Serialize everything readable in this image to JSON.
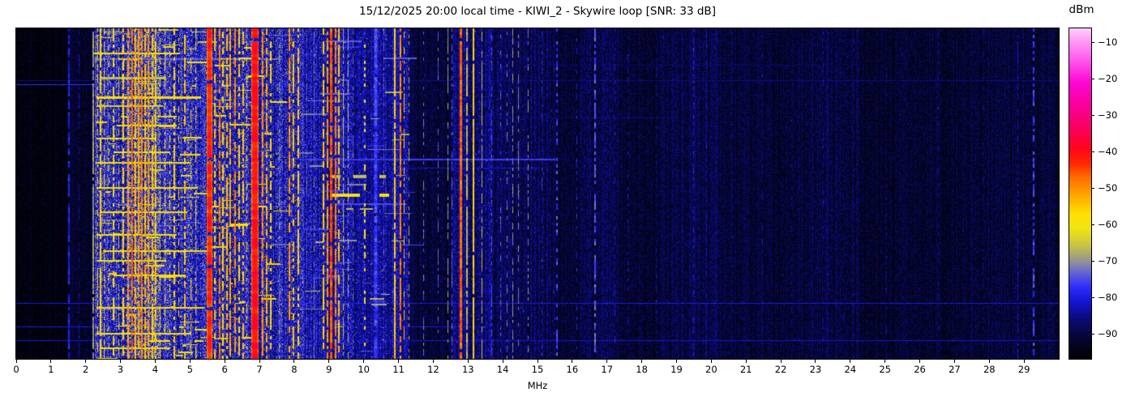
{
  "title": "15/12/2025 20:00 local time - KIWI_2 - Skywire loop [SNR: 33 dB]",
  "xaxis": {
    "label": "MHz",
    "range_mhz": [
      0,
      30
    ],
    "ticks": [
      0,
      1,
      2,
      3,
      4,
      5,
      6,
      7,
      8,
      9,
      10,
      11,
      12,
      13,
      14,
      15,
      16,
      17,
      18,
      19,
      20,
      21,
      22,
      23,
      24,
      25,
      26,
      27,
      28,
      29
    ]
  },
  "colorbar": {
    "label": "dBm",
    "vmax": -6,
    "vmin": -96.5,
    "ticks": [
      {
        "v": -10,
        "label": "−10"
      },
      {
        "v": -20,
        "label": "−20"
      },
      {
        "v": -30,
        "label": "−30"
      },
      {
        "v": -40,
        "label": "−40"
      },
      {
        "v": -50,
        "label": "−50"
      },
      {
        "v": -60,
        "label": "−60"
      },
      {
        "v": -70,
        "label": "−70"
      },
      {
        "v": -80,
        "label": "−80"
      },
      {
        "v": -90,
        "label": "−90"
      }
    ]
  },
  "chart_data": {
    "type": "heatmap",
    "subtype": "spectrogram-waterfall",
    "title": "15/12/2025 20:00 local time - KIWI_2 - Skywire loop [SNR: 33 dB]",
    "xlabel": "MHz",
    "x_range_mhz": [
      0,
      30
    ],
    "value_unit": "dBm",
    "value_range": [
      -96.5,
      -6
    ],
    "seed": 1337,
    "colormap_stops": [
      [
        -97,
        0,
        0,
        0
      ],
      [
        -91,
        6,
        6,
        50
      ],
      [
        -86,
        10,
        10,
        115
      ],
      [
        -81,
        20,
        20,
        210
      ],
      [
        -77,
        45,
        45,
        252
      ],
      [
        -73,
        100,
        100,
        215
      ],
      [
        -70,
        145,
        145,
        150
      ],
      [
        -66,
        195,
        192,
        75
      ],
      [
        -61,
        240,
        228,
        20
      ],
      [
        -57,
        255,
        225,
        0
      ],
      [
        -52,
        255,
        170,
        0
      ],
      [
        -47,
        255,
        110,
        0
      ],
      [
        -43,
        255,
        40,
        5
      ],
      [
        -39,
        255,
        5,
        25
      ],
      [
        -33,
        250,
        0,
        100
      ],
      [
        -27,
        250,
        0,
        155
      ],
      [
        -21,
        253,
        5,
        210
      ],
      [
        -15,
        255,
        85,
        235
      ],
      [
        -9,
        255,
        160,
        245
      ],
      [
        -5,
        255,
        225,
        253
      ]
    ],
    "noise_bands_format": [
      "f_start_mhz",
      "f_end_mhz",
      "base_dbm",
      "speckle_db",
      "spark_prob",
      "spark_dbm"
    ],
    "noise_bands": [
      [
        0.0,
        1.45,
        -95,
        2.5,
        0.004,
        -86
      ],
      [
        1.45,
        2.25,
        -92,
        4,
        0.008,
        -84
      ],
      [
        2.25,
        3.15,
        -80,
        9,
        0.03,
        -62
      ],
      [
        3.15,
        4.15,
        -78,
        10,
        0.08,
        -61
      ],
      [
        4.15,
        5.15,
        -80,
        9,
        0.03,
        -62
      ],
      [
        5.15,
        8.25,
        -81,
        9,
        0.02,
        -63
      ],
      [
        8.25,
        9.6,
        -83,
        8,
        0.01,
        -66
      ],
      [
        9.6,
        11.3,
        -84,
        7,
        0.008,
        -68
      ],
      [
        11.3,
        12.55,
        -91,
        5,
        0.004,
        -78
      ],
      [
        12.55,
        13.65,
        -86,
        7,
        0.006,
        -72
      ],
      [
        13.65,
        15.5,
        -89,
        6,
        0.004,
        -76
      ],
      [
        15.5,
        16.2,
        -91,
        5,
        0.002,
        -82
      ],
      [
        16.2,
        17.3,
        -89.5,
        6,
        0.002,
        -80
      ],
      [
        17.3,
        18.6,
        -91,
        5,
        0.002,
        -82
      ],
      [
        18.6,
        20.2,
        -90,
        5.5,
        0.002,
        -82
      ],
      [
        20.2,
        22.8,
        -91.5,
        5,
        0.0015,
        -83
      ],
      [
        22.8,
        24.2,
        -90.5,
        5.5,
        0.0015,
        -83
      ],
      [
        24.2,
        27.5,
        -91.5,
        5,
        0.0015,
        -84
      ],
      [
        27.5,
        30.0,
        -91,
        5,
        0.0015,
        -84
      ]
    ],
    "signals_format": [
      "freq_mhz",
      "width_mhz",
      "level_dbm",
      "duty"
    ],
    "signals": [
      [
        1.52,
        0.04,
        -79,
        0.75
      ],
      [
        1.8,
        0.03,
        -84,
        0.5
      ],
      [
        2.21,
        0.05,
        -70,
        0.9
      ],
      [
        2.33,
        0.03,
        -63,
        0.5
      ],
      [
        2.43,
        0.05,
        -57,
        0.85
      ],
      [
        2.52,
        0.03,
        -62,
        0.55
      ],
      [
        2.66,
        0.03,
        -65,
        0.5
      ],
      [
        2.8,
        0.04,
        -60,
        0.55
      ],
      [
        2.93,
        0.03,
        -63,
        0.5
      ],
      [
        3.07,
        0.04,
        -57,
        0.7
      ],
      [
        3.21,
        0.05,
        -51,
        0.8
      ],
      [
        3.34,
        0.05,
        -47,
        0.9
      ],
      [
        3.43,
        0.04,
        -54,
        0.8
      ],
      [
        3.53,
        0.05,
        -52,
        0.85
      ],
      [
        3.61,
        0.04,
        -49,
        0.9
      ],
      [
        3.71,
        0.04,
        -54,
        0.8
      ],
      [
        3.81,
        0.05,
        -51,
        0.85
      ],
      [
        3.92,
        0.04,
        -55,
        0.8
      ],
      [
        4.01,
        0.04,
        -56,
        0.7
      ],
      [
        4.13,
        0.03,
        -59,
        0.6
      ],
      [
        4.26,
        0.03,
        -61,
        0.5
      ],
      [
        4.41,
        0.03,
        -59,
        0.5
      ],
      [
        4.56,
        0.04,
        -57,
        0.6
      ],
      [
        4.66,
        0.03,
        -61,
        0.5
      ],
      [
        4.86,
        0.04,
        -56,
        0.6
      ],
      [
        5.01,
        0.03,
        -59,
        0.5
      ],
      [
        5.16,
        0.03,
        -62,
        0.5
      ],
      [
        5.56,
        0.16,
        -42,
        0.97
      ],
      [
        5.71,
        0.04,
        -55,
        0.6
      ],
      [
        5.86,
        0.05,
        -49,
        0.8
      ],
      [
        5.96,
        0.04,
        -56,
        0.6
      ],
      [
        6.06,
        0.04,
        -55,
        0.7
      ],
      [
        6.17,
        0.05,
        -52,
        0.8
      ],
      [
        6.29,
        0.04,
        -50,
        0.7
      ],
      [
        6.41,
        0.04,
        -56,
        0.6
      ],
      [
        6.53,
        0.04,
        -55,
        0.6
      ],
      [
        6.63,
        0.03,
        -58,
        0.5
      ],
      [
        6.86,
        0.22,
        -40,
        0.98
      ],
      [
        7.09,
        0.05,
        -50,
        0.8
      ],
      [
        7.21,
        0.05,
        -53,
        0.75
      ],
      [
        7.33,
        0.04,
        -57,
        0.6
      ],
      [
        7.56,
        0.03,
        -70,
        0.5
      ],
      [
        7.86,
        0.05,
        -51,
        0.8
      ],
      [
        7.98,
        0.04,
        -55,
        0.6
      ],
      [
        8.11,
        0.04,
        -56,
        0.7
      ],
      [
        8.36,
        0.03,
        -74,
        0.6
      ],
      [
        8.56,
        0.03,
        -72,
        0.5
      ],
      [
        8.84,
        0.04,
        -57,
        0.7
      ],
      [
        8.96,
        0.05,
        -51,
        0.8
      ],
      [
        9.06,
        0.06,
        -44,
        0.9
      ],
      [
        9.18,
        0.05,
        -49,
        0.85
      ],
      [
        9.28,
        0.04,
        -55,
        0.7
      ],
      [
        9.41,
        0.03,
        -67,
        0.8
      ],
      [
        9.53,
        0.03,
        -69,
        0.7
      ],
      [
        9.69,
        0.03,
        -74,
        0.5
      ],
      [
        10.02,
        0.04,
        -60,
        0.35
      ],
      [
        10.34,
        0.12,
        -76,
        0.95
      ],
      [
        10.57,
        0.03,
        -74,
        0.5
      ],
      [
        10.9,
        0.04,
        -56,
        0.9
      ],
      [
        11.06,
        0.04,
        -49,
        0.85
      ],
      [
        11.15,
        0.03,
        -54,
        0.5
      ],
      [
        11.28,
        0.03,
        -67,
        0.45
      ],
      [
        11.72,
        0.03,
        -72,
        0.4
      ],
      [
        12.12,
        0.03,
        -74,
        0.4
      ],
      [
        12.41,
        0.03,
        -69,
        0.5
      ],
      [
        12.52,
        0.03,
        -74,
        0.6
      ],
      [
        12.79,
        0.06,
        -45,
        0.92
      ],
      [
        12.97,
        0.04,
        -67,
        0.85
      ],
      [
        13.15,
        0.05,
        -56,
        0.95
      ],
      [
        13.39,
        0.03,
        -67,
        0.7
      ],
      [
        13.66,
        0.03,
        -76,
        0.55
      ],
      [
        13.92,
        0.03,
        -74,
        0.4
      ],
      [
        14.12,
        0.03,
        -72,
        0.5
      ],
      [
        14.28,
        0.03,
        -70,
        0.55
      ],
      [
        14.44,
        0.03,
        -71,
        0.5
      ],
      [
        14.72,
        0.03,
        -70,
        0.5
      ],
      [
        15.12,
        0.03,
        -78,
        0.4
      ],
      [
        15.57,
        0.04,
        -76,
        0.5
      ],
      [
        16.12,
        0.03,
        -80,
        0.4
      ],
      [
        16.66,
        0.04,
        -74,
        0.7
      ],
      [
        17.22,
        0.03,
        -81,
        0.4
      ],
      [
        17.58,
        0.03,
        -82,
        0.4
      ],
      [
        18.4,
        0.03,
        -84,
        0.35
      ],
      [
        19.48,
        0.03,
        -80,
        0.5
      ],
      [
        19.85,
        0.03,
        -83,
        0.4
      ],
      [
        20.6,
        0.03,
        -85,
        0.3
      ],
      [
        21.46,
        0.03,
        -84,
        0.35
      ],
      [
        22.3,
        0.03,
        -85,
        0.3
      ],
      [
        23.22,
        0.03,
        -84,
        0.35
      ],
      [
        24.1,
        0.03,
        -85,
        0.3
      ],
      [
        25.02,
        0.03,
        -85,
        0.3
      ],
      [
        26.52,
        0.03,
        -85,
        0.3
      ],
      [
        27.8,
        0.03,
        -85,
        0.3
      ],
      [
        28.82,
        0.03,
        -82,
        0.7
      ],
      [
        29.28,
        0.04,
        -76,
        0.55
      ]
    ],
    "streaks_format": [
      "y_px",
      "f_start_mhz",
      "f_end_mhz",
      "level_dbm",
      "height_px",
      "dashed"
    ],
    "streaks": [
      [
        31,
        2.25,
        4.7,
        -58,
        2,
        0
      ],
      [
        38,
        2.25,
        7.6,
        -73,
        2,
        0
      ],
      [
        45,
        15.4,
        23.0,
        -87,
        1,
        0
      ],
      [
        61,
        2.4,
        4.3,
        -66,
        3,
        0
      ],
      [
        64,
        0,
        30,
        -85,
        1,
        0
      ],
      [
        69,
        0,
        8.2,
        -77,
        1,
        0
      ],
      [
        85,
        2.3,
        5.3,
        -57,
        3,
        0
      ],
      [
        96,
        2.3,
        4.2,
        -63,
        2,
        0
      ],
      [
        110,
        13.6,
        19,
        -86,
        1,
        0
      ],
      [
        120,
        2.9,
        4.6,
        -58,
        2,
        0
      ],
      [
        136,
        2.3,
        4.0,
        -62,
        2,
        0
      ],
      [
        153,
        2.8,
        4.4,
        -60,
        2,
        0
      ],
      [
        162,
        8.3,
        15.5,
        -76,
        2,
        0
      ],
      [
        166,
        2.3,
        5.0,
        -59,
        2,
        0
      ],
      [
        172,
        10.0,
        15.0,
        -81,
        1,
        0
      ],
      [
        183,
        9.1,
        10.65,
        -66,
        4,
        1
      ],
      [
        193,
        9.3,
        10.3,
        -71,
        2,
        1
      ],
      [
        197,
        2.3,
        5.2,
        -60,
        2,
        0
      ],
      [
        206,
        9.05,
        10.7,
        -60,
        4,
        1
      ],
      [
        217,
        9.2,
        11.2,
        -75,
        2,
        0
      ],
      [
        223,
        9.5,
        10.4,
        -67,
        2,
        1
      ],
      [
        227,
        2.4,
        4.9,
        -58,
        2,
        0
      ],
      [
        255,
        2.3,
        4.6,
        -60,
        2,
        0
      ],
      [
        275,
        2.5,
        5.6,
        -59,
        2,
        0
      ],
      [
        287,
        2.3,
        4.3,
        -61,
        2,
        0
      ],
      [
        305,
        2.8,
        4.8,
        -58,
        2,
        0
      ],
      [
        339,
        0,
        30,
        -80,
        1,
        0
      ],
      [
        345,
        2.3,
        5.4,
        -58,
        2,
        0
      ],
      [
        368,
        0,
        13.5,
        -80,
        1,
        0
      ],
      [
        377,
        2.3,
        5.0,
        -59,
        2,
        0
      ],
      [
        385,
        0,
        30,
        -81,
        1,
        0
      ],
      [
        395,
        2.4,
        4.4,
        -60,
        2,
        0
      ]
    ],
    "procedural_dashes": [
      {
        "name": "yellow",
        "count": 100,
        "f_min": 2.25,
        "f_max": 7.5,
        "len_min": 0.06,
        "len_max": 0.6,
        "level_min": -66,
        "level_max": -55
      },
      {
        "name": "blue",
        "count": 60,
        "f_min": 2.25,
        "f_max": 11.2,
        "len_min": 0.1,
        "len_max": 1.0,
        "level_min": -78,
        "level_max": -72
      },
      {
        "name": "gray",
        "count": 14,
        "f_min": 8.3,
        "f_max": 11.25,
        "len_min": 0.1,
        "len_max": 0.5,
        "level_min": -70,
        "level_max": -64
      }
    ]
  }
}
